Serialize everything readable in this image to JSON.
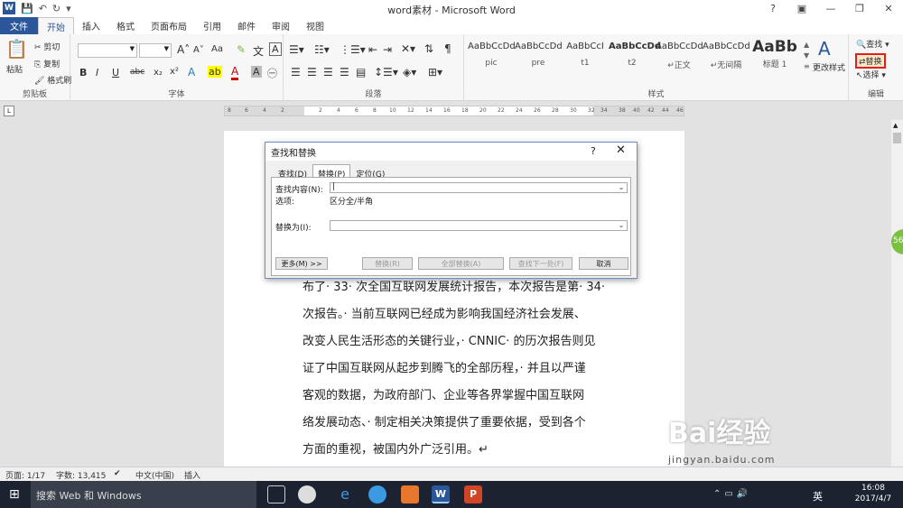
{
  "window": {
    "title": "word素材 - Microsoft Word"
  },
  "tabs": [
    "文件",
    "开始",
    "插入",
    "格式",
    "页面布局",
    "引用",
    "邮件",
    "审阅",
    "视图"
  ],
  "ribbon": {
    "clipboard": {
      "paste": "粘贴",
      "cut": "剪切",
      "copy": "复制",
      "format_painter": "格式刷",
      "label": "剪贴板"
    },
    "font": {
      "label": "字体",
      "grow": "A",
      "shrink": "A",
      "clear": "Aa",
      "bold": "B",
      "italic": "I",
      "underline": "U",
      "strike": "abc"
    },
    "paragraph": {
      "label": "段落"
    },
    "styles": {
      "label": "样式",
      "items": [
        {
          "sample": "AaBbCcDd",
          "name": "pic"
        },
        {
          "sample": "AaBbCcDd",
          "name": "pre"
        },
        {
          "sample": "AaBbCcI",
          "name": "t1"
        },
        {
          "sample": "AaBbCcDd",
          "name": "t2"
        },
        {
          "sample": "AaBbCcDd",
          "name": "↵正文"
        },
        {
          "sample": "AaBbCcDd",
          "name": "↵无间隔"
        },
        {
          "sample": "AaBb",
          "name": "标题 1"
        }
      ],
      "change": "更改样式"
    },
    "editing": {
      "find": "查找",
      "replace": "替换",
      "select": "选择",
      "label": "编辑"
    }
  },
  "ruler": {
    "ticks": [
      "8",
      "6",
      "4",
      "2",
      "2",
      "4",
      "6",
      "8",
      "10",
      "12",
      "14",
      "16",
      "18",
      "20",
      "22",
      "24",
      "26",
      "28",
      "30",
      "32",
      "34",
      "38",
      "40",
      "42",
      "44",
      "46",
      "48"
    ]
  },
  "dialog": {
    "title": "查找和替换",
    "help": "?",
    "tabs": [
      "查找(D)",
      "替换(P)",
      "定位(G)"
    ],
    "find_label": "查找内容(N):",
    "options_label": "选项:",
    "options_value": "区分全/半角",
    "replace_label": "替换为(I):",
    "buttons": {
      "more": "更多(M) >>",
      "replace": "替换(R)",
      "replace_all": "全部替换(A)",
      "find_next": "查找下一处(F)",
      "cancel": "取消"
    }
  },
  "document": {
    "lines": [
      "布了· 33· 次全国互联网发展统计报告，本次报告是第· 34·",
      "次报告。· 当前互联网已经成为影响我国经济社会发展、",
      "改变人民生活形态的关键行业，· CNNIC· 的历次报告则见",
      "证了中国互联网从起步到腾飞的全部历程，· 并且以严谨",
      "客观的数据，为政府部门、企业等各界掌握中国互联网",
      "络发展动态、· 制定相关决策提供了重要依据，受到各个",
      "方面的重视，被国内外广泛引用。↵"
    ]
  },
  "statusbar": {
    "page": "页面: 1/17",
    "words": "字数: 13,415",
    "lang": "中文(中国)",
    "mode": "插入"
  },
  "taskbar": {
    "search": "搜索 Web 和 Windows",
    "time": "16:08",
    "date": "2017/4/7",
    "ime": "英"
  },
  "watermark": {
    "brand": "Bai经验",
    "url": "jingyan.baidu.com"
  },
  "side_badge": "56"
}
